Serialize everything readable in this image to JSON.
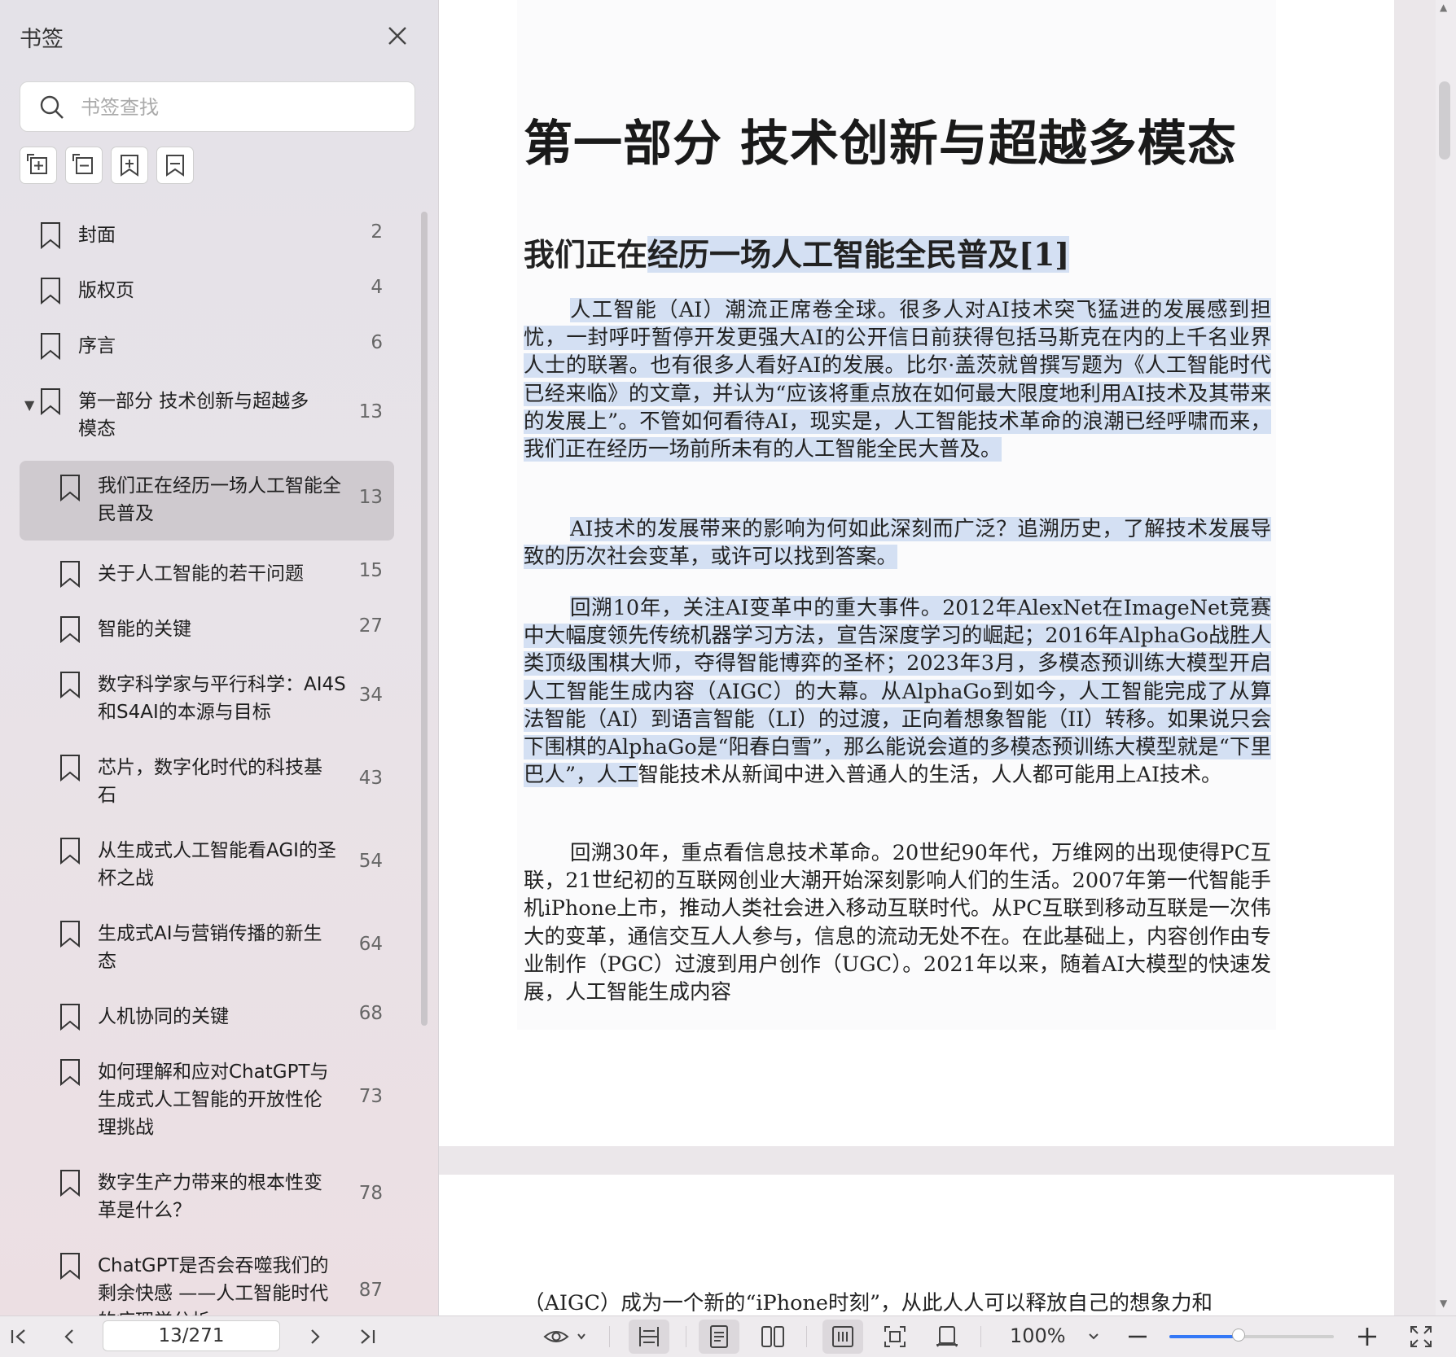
{
  "sidebar": {
    "title": "书签",
    "search_placeholder": "书签查找",
    "tools": [
      "expand-all-icon",
      "collapse-all-icon",
      "add-bookmark-icon",
      "bookmark-toggle-icon"
    ],
    "items": [
      {
        "label": "封面",
        "page": "2",
        "level": 0
      },
      {
        "label": "版权页",
        "page": "4",
        "level": 0
      },
      {
        "label": "序言",
        "page": "6",
        "level": 0
      },
      {
        "label": "第一部分 技术创新与超越多模态",
        "page": "13",
        "level": 0,
        "expanded": true
      },
      {
        "label": "我们正在经历一场人工智能全民普及",
        "page": "13",
        "level": 1,
        "selected": true
      },
      {
        "label": "关于人工智能的若干问题",
        "page": "15",
        "level": 1
      },
      {
        "label": "智能的关键",
        "page": "27",
        "level": 1
      },
      {
        "label": "数字科学家与平行科学：AI4S和S4AI的本源与目标",
        "page": "34",
        "level": 1
      },
      {
        "label": "芯片，数字化时代的科技基石",
        "page": "43",
        "level": 1
      },
      {
        "label": "从生成式人工智能看AGI的圣杯之战",
        "page": "54",
        "level": 1
      },
      {
        "label": "生成式AI与营销传播的新生态",
        "page": "64",
        "level": 1
      },
      {
        "label": "人机协同的关键",
        "page": "68",
        "level": 1
      },
      {
        "label": "如何理解和应对ChatGPT与生成式人工智能的开放性伦理挑战",
        "page": "73",
        "level": 1
      },
      {
        "label": "数字生产力带来的根本性变革是什么？",
        "page": "78",
        "level": 1
      },
      {
        "label": "ChatGPT是否会吞噬我们的剩余快感 ——人工智能时代的病理学分析",
        "page": "87",
        "level": 1
      }
    ]
  },
  "document": {
    "h1": "第一部分 技术创新与超越多模态",
    "h2_plain": "我们正在",
    "h2_highlight": "经历一场人工智能全民普及[1]",
    "p1": "人工智能（AI）潮流正席卷全球。很多人对AI技术突飞猛进的发展感到担忧，一封呼吁暂停开发更强大AI的公开信日前获得包括马斯克在内的上千名业界人士的联署。也有很多人看好AI的发展。比尔·盖茨就曾撰写题为《人工智能时代已经来临》的文章，并认为“应该将重点放在如何最大限度地利用AI技术及其带来的发展上”。不管如何看待AI，现实是，人工智能技术革命的浪潮已经呼啸而来，我们正在经历一场前所未有的人工智能全民大普及。",
    "p2": "AI技术的发展带来的影响为何如此深刻而广泛？追溯历史，了解技术发展导致的历次社会变革，或许可以找到答案。",
    "p3_highlight": "回溯10年，关注AI变革中的重大事件。2012年AlexNet在ImageNet竞赛中大幅度领先传统机器学习方法，宣告深度学习的崛起；2016年AlphaGo战胜人类顶级围棋大师，夺得智能博弈的圣杯；2023年3月，多模态预训练大模型开启人工智能生成内容（AIGC）的大幕。从AlphaGo到如今，人工智能完成了从算法智能（AI）到语言智能（LI）的过渡，正向着想象智能（II）转移。如果说只会下围棋的AlphaGo是“阳春白雪”，那么能说会道的多模态预训练大模型就是“下里巴人”，人工",
    "p3_plain": "智能技术从新闻中进入普通人的生活，人人都可能用上AI技术。",
    "p4": "回溯30年，重点看信息技术革命。20世纪90年代，万维网的出现使得PC互联，21世纪初的互联网创业大潮开始深刻影响人们的生活。2007年第一代智能手机iPhone上市，推动人类社会进入移动互联时代。从PC互联到移动互联是一次伟大的变革，通信交互人人参与，信息的流动无处不在。在此基础上，内容创作由专业制作（PGC）过渡到用户创作（UGC）。2021年以来，随着AI大模型的快速发展，人工智能生成内容",
    "page2_line": "（AIGC）成为一个新的“iPhone时刻”，从此人人可以释放自己的想象力和"
  },
  "toolbar": {
    "page_indicator": "13/271",
    "zoom": "100%",
    "zoom_level": 0.42
  },
  "colors": {
    "highlight": "#d4e0f3",
    "accent": "#3478f6",
    "selected_row": "#cfcacf"
  }
}
